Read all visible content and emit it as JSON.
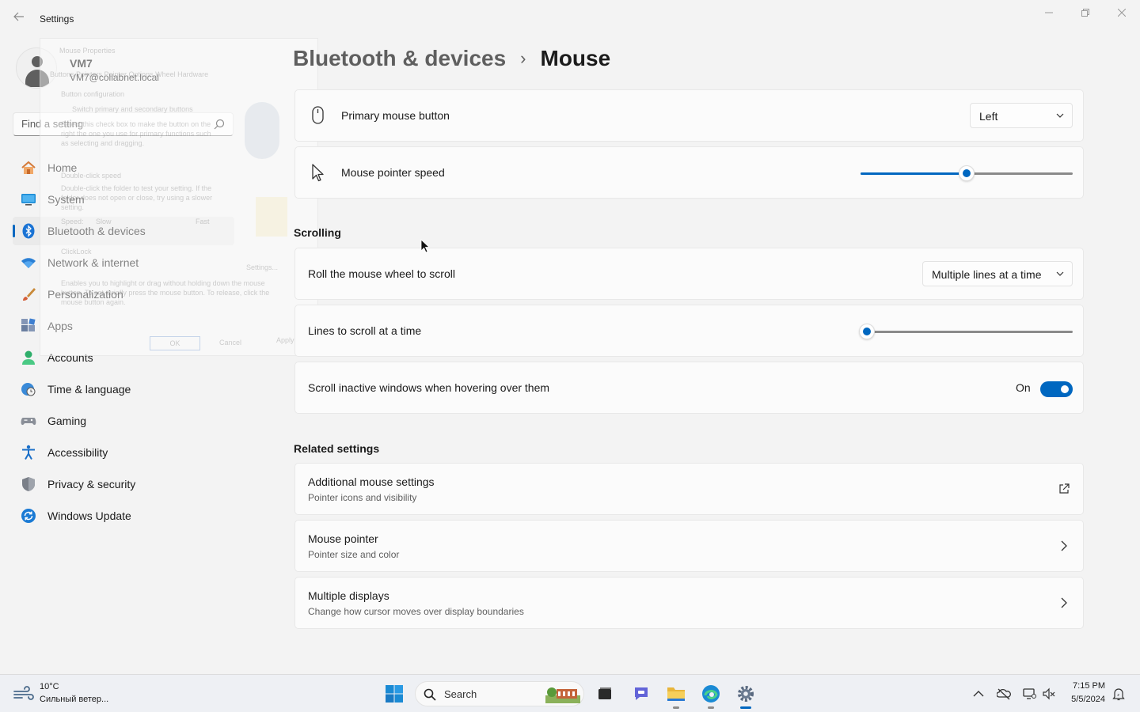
{
  "window": {
    "title": "Settings",
    "back_icon": "back-arrow-icon",
    "controls": [
      "minimize-icon",
      "maximize-icon",
      "close-icon"
    ]
  },
  "profile": {
    "name": "VM7",
    "email": "VM7@collabnet.local"
  },
  "search": {
    "placeholder": "Find a setting"
  },
  "nav": {
    "items": [
      {
        "label": "Home",
        "icon": "home-icon"
      },
      {
        "label": "System",
        "icon": "system-icon"
      },
      {
        "label": "Bluetooth & devices",
        "icon": "bluetooth-icon",
        "active": true
      },
      {
        "label": "Network & internet",
        "icon": "wifi-icon"
      },
      {
        "label": "Personalization",
        "icon": "brush-icon"
      },
      {
        "label": "Apps",
        "icon": "apps-icon"
      },
      {
        "label": "Accounts",
        "icon": "accounts-icon"
      },
      {
        "label": "Time & language",
        "icon": "globe-clock-icon"
      },
      {
        "label": "Gaming",
        "icon": "gamepad-icon"
      },
      {
        "label": "Accessibility",
        "icon": "accessibility-icon"
      },
      {
        "label": "Privacy & security",
        "icon": "shield-icon"
      },
      {
        "label": "Windows Update",
        "icon": "update-icon"
      }
    ]
  },
  "ghost_dialog": {
    "title": "Mouse Properties",
    "tabs": "Buttons  Pointers  Pointer Options  Wheel  Hardware",
    "group": "Button configuration",
    "switch": "Switch primary and secondary buttons",
    "switch_desc": "Select this check box to make the button on the right the one you use for primary functions such as selecting and dragging.",
    "dbl_group": "Double-click speed",
    "dbl_desc": "Double-click the folder to test your setting. If the folder does not open or close, try using a slower setting.",
    "speed": "Speed:",
    "slow": "Slow",
    "fast": "Fast",
    "clicklock": "ClickLock",
    "settings": "Settings...",
    "clicklock_desc": "Enables you to highlight or drag without holding down the mouse button. To set, briefly press the mouse button. To release, click the mouse button again.",
    "ok": "OK",
    "cancel": "Cancel",
    "apply": "Apply"
  },
  "breadcrumb": {
    "parent": "Bluetooth & devices",
    "separator": "›",
    "current": "Mouse"
  },
  "settings": {
    "primary_button": {
      "label": "Primary mouse button",
      "icon": "mouse-icon",
      "value": "Left"
    },
    "pointer_speed": {
      "label": "Mouse pointer speed",
      "icon": "pointer-icon",
      "value": 0.5
    },
    "scrolling_header": "Scrolling",
    "roll_wheel": {
      "label": "Roll the mouse wheel to scroll",
      "value": "Multiple lines at a time"
    },
    "lines_to_scroll": {
      "label": "Lines to scroll at a time",
      "value": 0.03
    },
    "scroll_inactive": {
      "label": "Scroll inactive windows when hovering over them",
      "state": "On",
      "on": true
    },
    "related_header": "Related settings",
    "related": [
      {
        "title": "Additional mouse settings",
        "desc": "Pointer icons and visibility",
        "icon": "external-link-icon"
      },
      {
        "title": "Mouse pointer",
        "desc": "Pointer size and color",
        "icon": "chevron-right-icon"
      },
      {
        "title": "Multiple displays",
        "desc": "Change how cursor moves over display boundaries",
        "icon": "chevron-right-icon"
      }
    ]
  },
  "taskbar": {
    "weather": {
      "temp": "10°C",
      "desc": "Сильный ветер...",
      "icon": "wind-icon"
    },
    "search_label": "Search",
    "apps": [
      "windows-start-icon",
      "task-view-icon",
      "chat-icon",
      "file-explorer-icon",
      "edge-icon",
      "settings-icon"
    ],
    "tray": [
      "chevron-up-icon",
      "onedrive-off-icon",
      "network-icon",
      "volume-icon"
    ],
    "time": "7:15 PM",
    "date": "5/5/2024",
    "notification_icon": "notification-icon"
  },
  "colors": {
    "accent": "#0067c0",
    "background": "#f3f3f3",
    "card": "#fbfbfb"
  }
}
